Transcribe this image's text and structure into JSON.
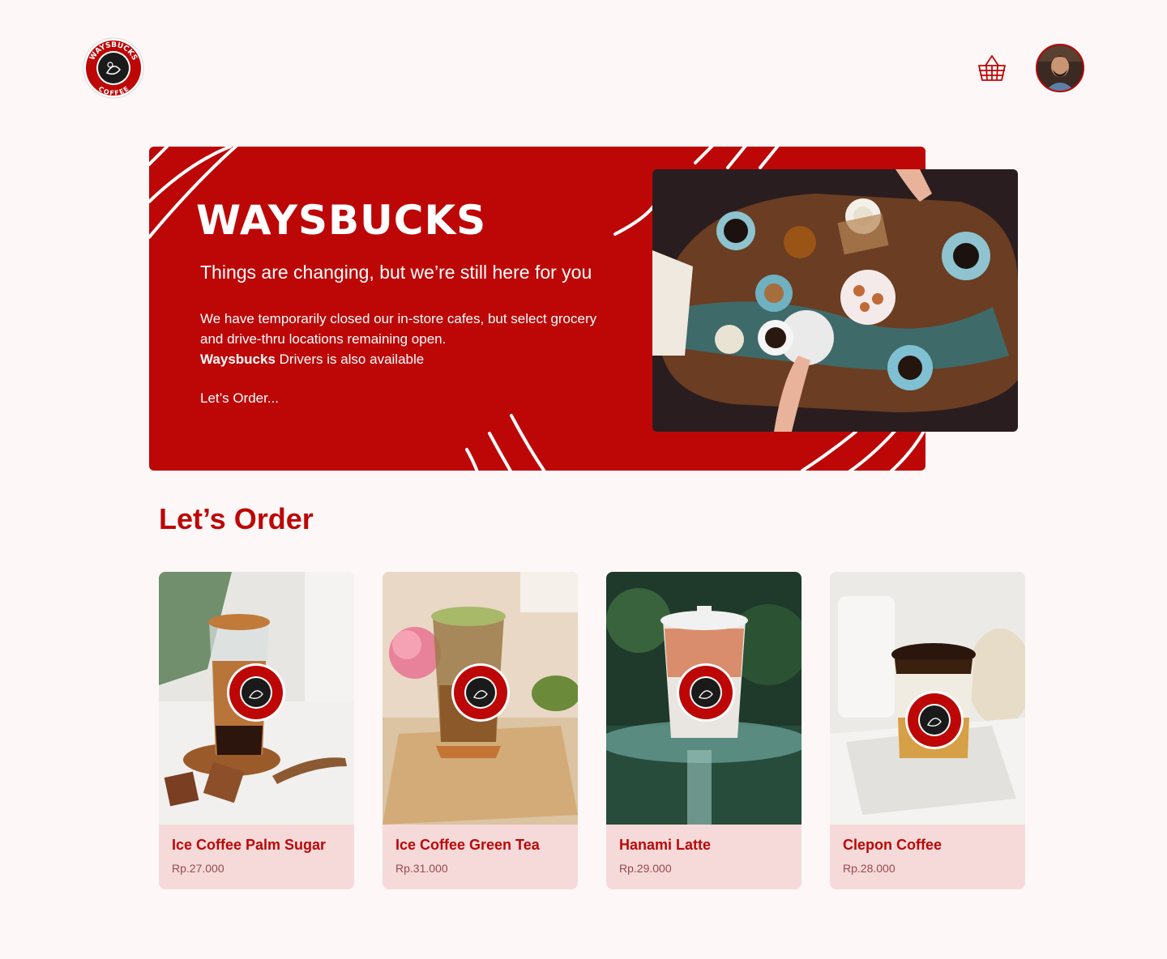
{
  "header": {
    "brand_top": "WAYSBUCKS",
    "brand_bottom": "COFFEE"
  },
  "hero": {
    "title": "WAYSBUCKS",
    "subtitle": "Things are changing, but we’re still here for you",
    "body_line1": "We have temporarily closed our in-store cafes, but select grocery and drive-thru locations remaining open.",
    "body_brand": "Waysbucks",
    "body_line2": " Drivers is also available",
    "cta": "Let’s Order..."
  },
  "section": {
    "title": "Let’s Order"
  },
  "products": [
    {
      "name": "Ice Coffee Palm Sugar",
      "price": "Rp.27.000"
    },
    {
      "name": "Ice Coffee Green Tea",
      "price": "Rp.31.000"
    },
    {
      "name": "Hanami Latte",
      "price": "Rp.29.000"
    },
    {
      "name": "Clepon Coffee",
      "price": "Rp.28.000"
    }
  ],
  "colors": {
    "brand_red": "#bd0707",
    "card_bg": "#f6dada",
    "page_bg": "#fdf8f7"
  },
  "icons": [
    "logo-icon",
    "basket-icon",
    "avatar"
  ]
}
